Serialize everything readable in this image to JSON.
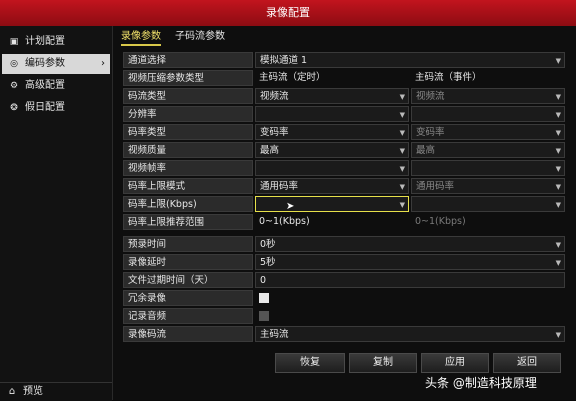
{
  "window": {
    "title": "录像配置"
  },
  "sidebar": {
    "items": [
      {
        "label": "计划配置",
        "icon": "calendar-icon"
      },
      {
        "label": "编码参数",
        "icon": "encode-icon",
        "active": true
      },
      {
        "label": "高级配置",
        "icon": "gear-icon"
      },
      {
        "label": "假日配置",
        "icon": "holiday-icon"
      }
    ],
    "preview": "预览"
  },
  "tabs": [
    {
      "label": "录像参数"
    },
    {
      "label": "子码流参数"
    }
  ],
  "form": {
    "rows": [
      {
        "label": "通道选择",
        "value": "模拟通道 1"
      },
      {
        "label": "视频压缩参数类型",
        "c1": "主码流（定时）",
        "c2": "主码流（事件）"
      },
      {
        "label": "码流类型",
        "c1": "视频流",
        "c2": "视频流"
      },
      {
        "label": "分辨率",
        "c1": "",
        "c2": ""
      },
      {
        "label": "码率类型",
        "c1": "变码率",
        "c2": "变码率"
      },
      {
        "label": "视频质量",
        "c1": "最高",
        "c2": "最高"
      },
      {
        "label": "视频帧率",
        "c1": "",
        "c2": ""
      },
      {
        "label": "码率上限模式",
        "c1": "通用码率",
        "c2": "通用码率"
      },
      {
        "label": "码率上限(Kbps)",
        "c1": "",
        "c2": ""
      },
      {
        "label": "码率上限推荐范围",
        "c1": "0~1(Kbps)",
        "c2": "0~1(Kbps)"
      },
      {
        "label": "预录时间",
        "value": "0秒"
      },
      {
        "label": "录像延时",
        "value": "5秒"
      },
      {
        "label": "文件过期时间（天）",
        "value": "0"
      },
      {
        "label": "冗余录像",
        "checked": true
      },
      {
        "label": "记录音频",
        "checked": false
      },
      {
        "label": "录像码流",
        "value": "主码流"
      }
    ]
  },
  "buttons": {
    "restore": "恢复",
    "copy": "复制",
    "apply": "应用",
    "back": "返回"
  },
  "watermark": "头条 @制造科技原理"
}
